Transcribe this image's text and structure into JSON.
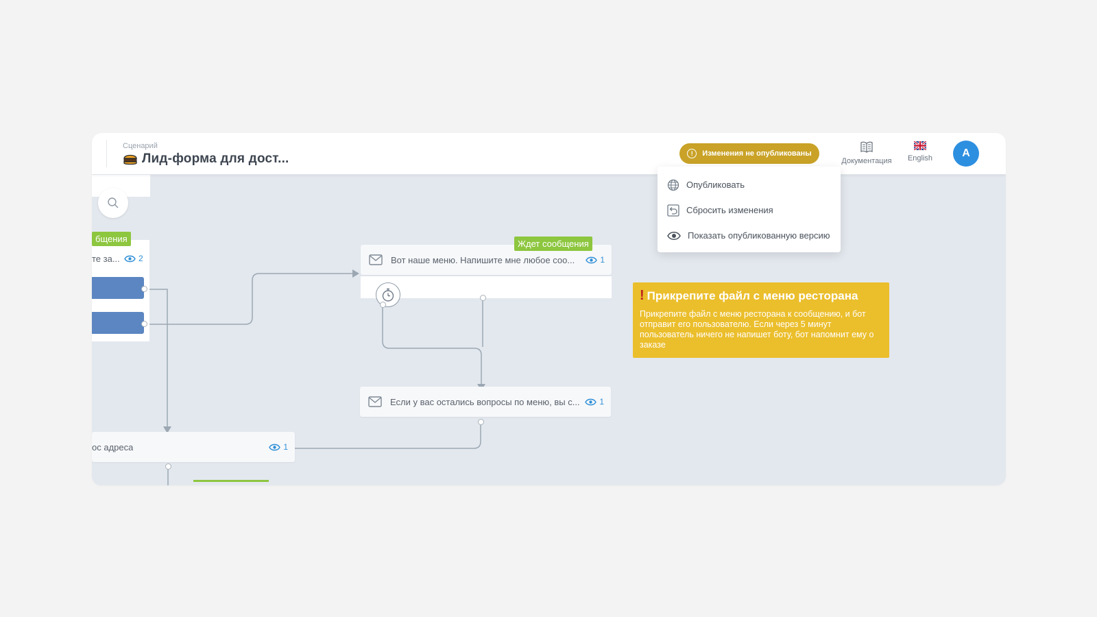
{
  "header": {
    "caption": "Сценарий",
    "title": "Лид-форма для дост...",
    "status_button": "Изменения не опубликованы",
    "docs_label": "Документация",
    "lang_label": "English",
    "avatar_initial": "A"
  },
  "dropdown": {
    "items": [
      {
        "label": "Опубликовать",
        "icon": "globe-icon"
      },
      {
        "label": "Сбросить изменения",
        "icon": "reset-icon"
      },
      {
        "label": "Показать опубликованную версию",
        "icon": "eye-icon"
      }
    ]
  },
  "canvas": {
    "left_tag": "бщения",
    "left_node_text": "те за...",
    "left_node_views": "2",
    "node1": {
      "tag": "Ждет сообщения",
      "text": "Вот наше меню. Напишите мне любое соо...",
      "views": "1"
    },
    "node2": {
      "text": "Если у вас остались вопросы по меню, вы с...",
      "views": "1"
    },
    "node3": {
      "text": "ос адреса",
      "views": "1"
    },
    "note": {
      "title": "Прикрепите файл с меню ресторана",
      "body": "Прикрепите файл с меню ресторана к сообщению, и бот отправит его пользователю. Если через 5 минут пользователь ничего не напишет боту, бот напомнит ему о заказе"
    }
  },
  "colors": {
    "status_button": "#c9a227",
    "note_bg": "#ebbe2c",
    "tag_green": "#8dc63f",
    "avatar_blue": "#2d8fe0",
    "button_blue": "#5b86c2"
  }
}
